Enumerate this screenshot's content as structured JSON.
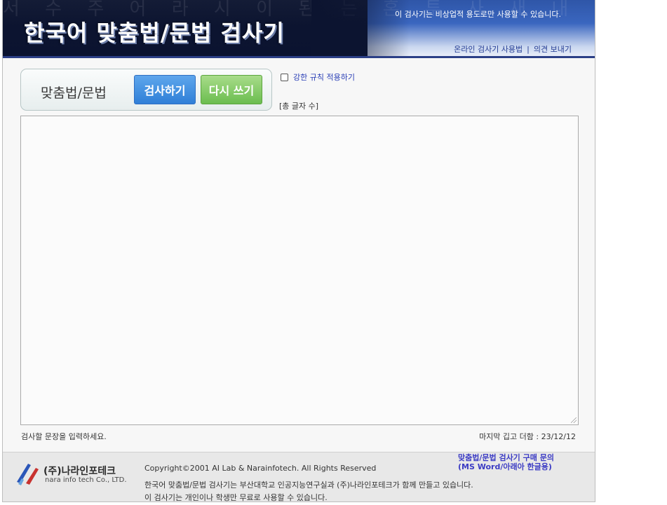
{
  "header": {
    "title": "한국어 맞춤법/문법 검사기",
    "notice": "이 검사기는 비상업적 용도로만 사용할 수 있습니다.",
    "links": [
      "온라인 검사기 사용법",
      "의견 보내기"
    ],
    "link_separator": "|",
    "background_text": "서 수 주 어 라 시 이 된 는 혼 투 사 새 내 가 한 하 나 는 에 다 화 술 논 위 소 에 어 을 러 다 다 이 가"
  },
  "panel": {
    "label": "맞춤법/문법",
    "check_button": "검사하기",
    "reset_button": "다시 쓰기",
    "check_button_color": "#2f7fd7",
    "reset_button_color": "#6bbd4f"
  },
  "options": {
    "strict_label": "강한 규칙 적용하기",
    "strict_checked": false,
    "char_count_label": "[총 글자 수]"
  },
  "editor": {
    "value": "",
    "hint": "검사할 문장을 입력하세요.",
    "last_update": "마지막 깁고 더함 : 23/12/12"
  },
  "footer": {
    "company": "(주)나라인포테크",
    "company_en": "nara info tech Co., LTD.",
    "copyright": "Copyright©2001 AI Lab & Narainfotech. All Rights Reserved",
    "line1": "한국어 맞춤법/문법 검사기는 부산대학교 인공지능연구실과 (주)나라인포테크가 함께 만들고 있습니다.",
    "line2": "이 검사기는 개인이나 학생만 무료로 사용할 수 있습니다.",
    "purchase_line1": "맞춤법/문법 검사기 구매 문의",
    "purchase_line2": "(MS Word/아래아 한글용)"
  },
  "colors": {
    "header_dark": "#0c1430",
    "header_blue": "#3a66bf",
    "link_blue": "#243d94",
    "purchase_blue": "#3b3bc4"
  }
}
